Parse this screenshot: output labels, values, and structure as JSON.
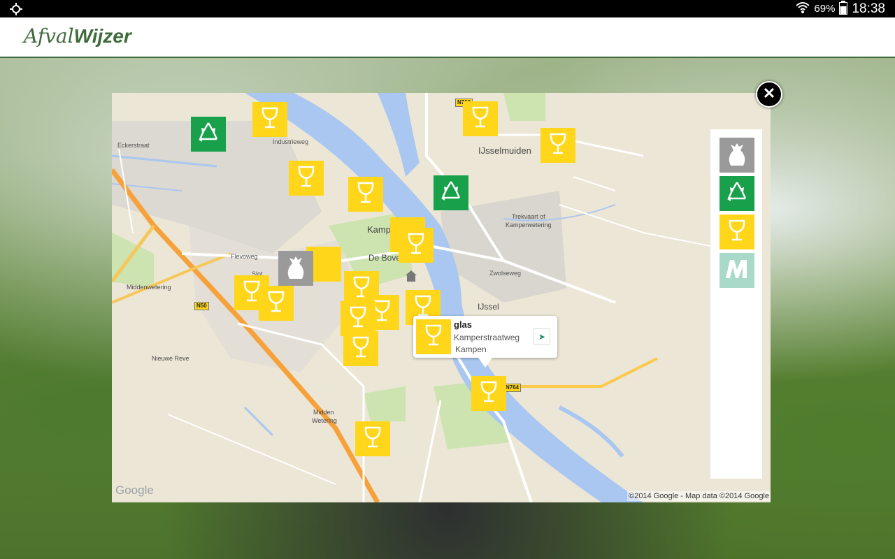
{
  "status_bar": {
    "battery": "69%",
    "time": "18:38"
  },
  "app": {
    "logo_part1": "Afval",
    "logo_part2": "Wijzer"
  },
  "map": {
    "places": {
      "ijsselmuiden": "IJsselmuiden",
      "kampen": "Kampen",
      "de_boven": "De Boven",
      "ijssel": "IJssel",
      "middenwetering": "Middenwetering",
      "nieuwe_reve": "Nieuwe Reve",
      "midden": "Midden",
      "wetering": "Wetering",
      "trekvaart1": "Trekvaart of",
      "trekvaart2": "Kamperwetering"
    },
    "roads": {
      "n50": "N50",
      "n764": "N764",
      "n760": "N760",
      "flevoweg": "Flevoweg",
      "zwolseweg": "Zwolseweg",
      "industrieweg": "Industrieweg",
      "slot": "Slot",
      "ecklerstraat": "Eckerstraat"
    },
    "google_logo": "Google",
    "copyright": "©2014 Google - Map data ©2014 Google"
  },
  "popup": {
    "title": "glas",
    "street": "Kamperstraatweg",
    "city": "Kampen"
  },
  "legend": {
    "items": [
      "restafval",
      "recycling",
      "glas",
      "metro"
    ]
  },
  "colors": {
    "glass": "#ffd61a",
    "recycle": "#19a04b",
    "rest": "#9a9a9a",
    "metro": "#a9d9c9",
    "brand": "#3e6b3a"
  }
}
